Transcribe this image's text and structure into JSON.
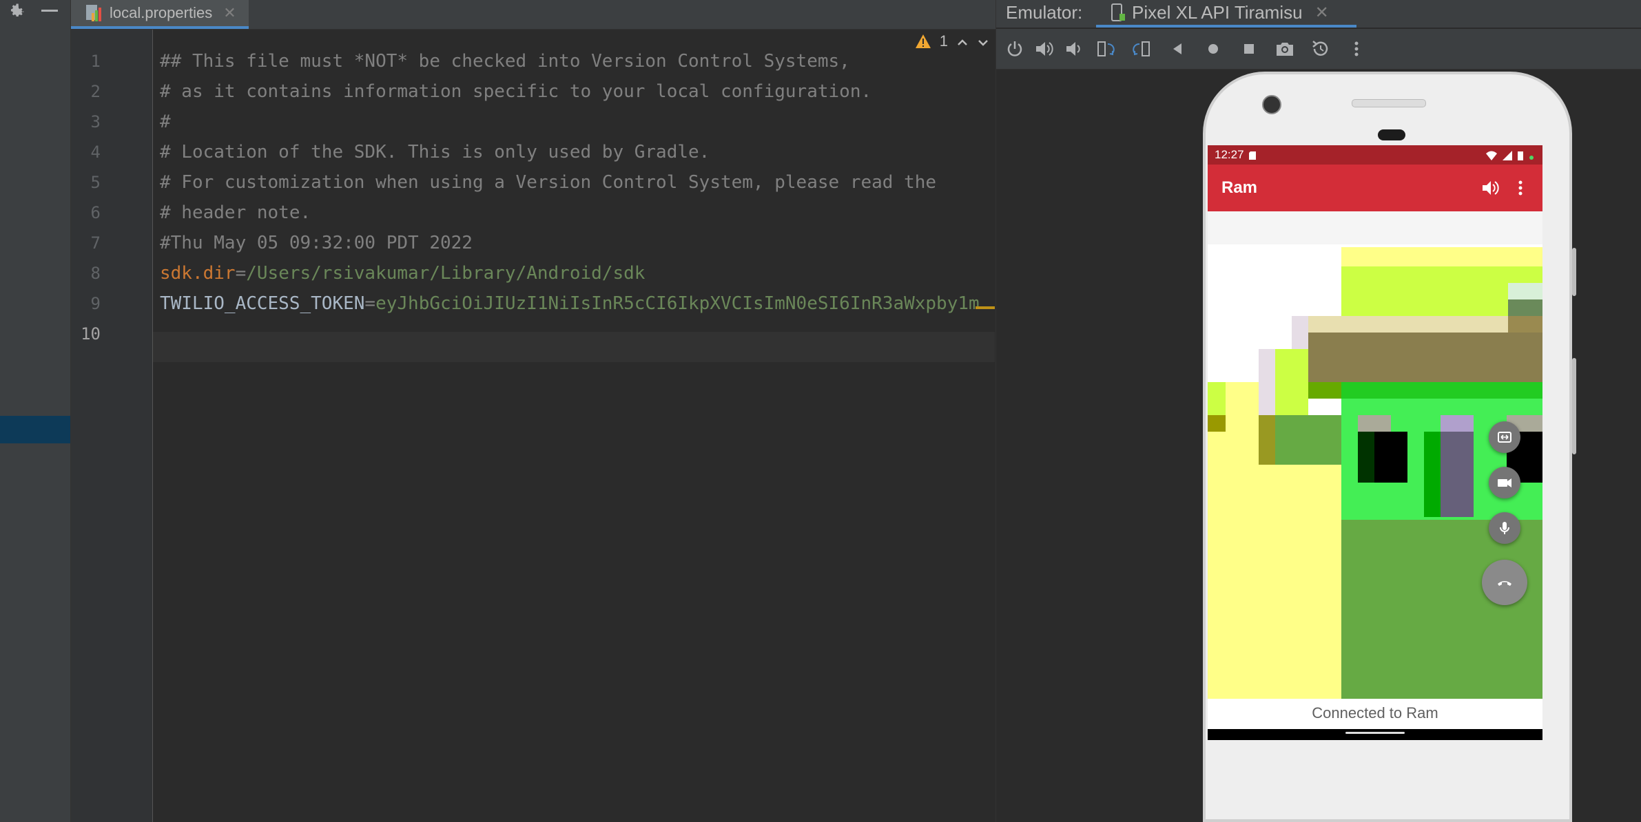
{
  "editor": {
    "tab": {
      "label": "local.properties"
    },
    "inspection": {
      "warning_count": "1"
    },
    "line_numbers": [
      "1",
      "2",
      "3",
      "4",
      "5",
      "6",
      "7",
      "8",
      "9",
      "10"
    ],
    "lines": [
      "## This file must *NOT* be checked into Version Control Systems,",
      "# as it contains information specific to your local configuration.",
      "#",
      "# Location of the SDK. This is only used by Gradle.",
      "# For customization when using a Version Control System, please read the",
      "# header note.",
      "#Thu May 05 09:32:00 PDT 2022"
    ],
    "sdk_line": {
      "key": "sdk.dir",
      "sep": "=",
      "value": "/Users/rsivakumar/Library/Android/sdk"
    },
    "token_line": {
      "key": "TWILIO_ACCESS_TOKEN",
      "sep": "=",
      "value": "eyJhbGciOiJIUzI1NiIsInR5cCI6IkpXVCIsImN0eSI6InR3aWxpby1m"
    }
  },
  "emulator": {
    "title": "Emulator:",
    "tab_label": "Pixel XL API Tiramisu",
    "toolbar_icons": [
      "power-icon",
      "volume-up-icon",
      "volume-down-icon",
      "rotate-left-icon",
      "rotate-right-icon",
      "back-icon",
      "home-icon",
      "overview-icon",
      "screenshot-icon",
      "snapshot-icon",
      "more-icon"
    ]
  },
  "phone": {
    "status_time": "12:27",
    "app_title": "Ram",
    "call_status": "Connected to Ram",
    "fab_icons": [
      "switch-camera-icon",
      "video-camera-icon",
      "microphone-icon",
      "end-call-icon"
    ]
  },
  "colors": {
    "app_bar": "#d32d38",
    "status_bar": "#a52229",
    "comment": "#808080",
    "key": "#cc7832",
    "value": "#6a8759",
    "accent": "#4a88c7"
  }
}
